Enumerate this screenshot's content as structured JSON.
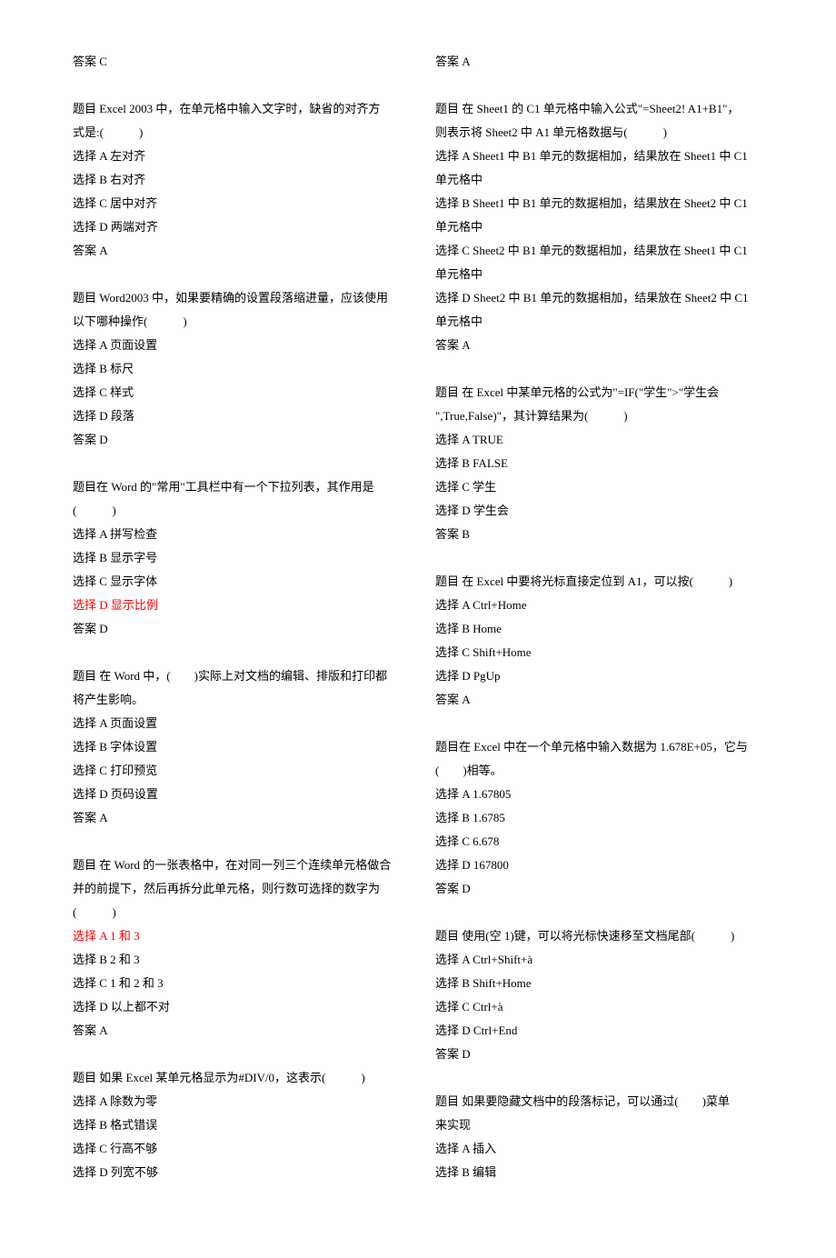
{
  "left": {
    "ans0": "答案 C",
    "q1": {
      "stem1": "题目 Excel 2003 中，在单元格中输入文字时，缺省的对齐方",
      "stem2": "式是:(　　　)",
      "a": "选择 A 左对齐",
      "b": "选择 B 右对齐",
      "c": "选择 C 居中对齐",
      "d": "选择 D 两端对齐",
      "ans": "答案 A"
    },
    "q2": {
      "stem1": "题目 Word2003 中，如果要精确的设置段落缩进量，应该使用",
      "stem2": "以下哪种操作(　　　)",
      "a": "选择 A 页面设置",
      "b": "选择 B 标尺",
      "c": "选择 C 样式",
      "d": "选择 D 段落",
      "ans": "答案 D"
    },
    "q3": {
      "stem1": "题目在 Word 的\"常用\"工具栏中有一个下拉列表，其作用是",
      "stem2": "(　　　)",
      "a": "选择 A 拼写检查",
      "b": "选择 B 显示字号",
      "c": "选择 C 显示字体",
      "d": "选择 D 显示比例",
      "ans": "答案 D"
    },
    "q4": {
      "stem1": "题目 在 Word 中，(　　)实际上对文档的编辑、排版和打印都",
      "stem2": "将产生影响。",
      "a": "选择 A 页面设置",
      "b": "选择 B 字体设置",
      "c": "选择 C 打印预览",
      "d": "选择 D 页码设置",
      "ans": "答案 A"
    },
    "q5": {
      "stem1": "题目 在 Word 的一张表格中，在对同一列三个连续单元格做合",
      "stem2": "并的前提下，然后再拆分此单元格，则行数可选择的数字为",
      "stem3": "(　　　)",
      "a": "选择 A 1 和 3",
      "b": "选择 B 2 和 3",
      "c": "选择 C 1 和 2 和 3",
      "d": "选择 D 以上都不对",
      "ans": "答案 A"
    },
    "q6": {
      "stem1": "题目 如果 Excel 某单元格显示为#DIV/0，这表示(　　　)",
      "a": "选择 A 除数为零",
      "b": "选择 B 格式错误",
      "c": "选择 C 行高不够",
      "d": "选择 D 列宽不够"
    }
  },
  "right": {
    "ans0": "答案 A",
    "q1": {
      "stem1": "题目 在 Sheet1 的 C1 单元格中输入公式\"=Sheet2! A1+B1\"，",
      "stem2": "则表示将 Sheet2 中 A1 单元格数据与(　　　)",
      "a1": "选择 A Sheet1 中 B1 单元的数据相加，结果放在 Sheet1 中 C1",
      "a2": "单元格中",
      "b1": "选择 B Sheet1 中 B1 单元的数据相加，结果放在 Sheet2 中 C1",
      "b2": "单元格中",
      "c1": "选择 C Sheet2 中 B1 单元的数据相加，结果放在 Sheet1 中 C1",
      "c2": "单元格中",
      "d1": "选择 D Sheet2 中 B1 单元的数据相加，结果放在 Sheet2 中 C1",
      "d2": "单元格中",
      "ans": "答案 A"
    },
    "q2": {
      "stem1": "题目 在 Excel 中某单元格的公式为\"=IF(\"学生\">\"学生会",
      "stem2": "\",True,False)\"，其计算结果为(　　　)",
      "a": "选择 A TRUE",
      "b": "选择 B FALSE",
      "c": "选择 C 学生",
      "d": "选择 D 学生会",
      "ans": "答案 B"
    },
    "q3": {
      "stem1": "题目 在 Excel 中要将光标直接定位到 A1，可以按(　　　)",
      "a": "选择 A Ctrl+Home",
      "b": "选择 B Home",
      "c": "选择 C Shift+Home",
      "d": "选择 D PgUp",
      "ans": "答案 A"
    },
    "q4": {
      "stem1": "题目在 Excel 中在一个单元格中输入数据为 1.678E+05，它与",
      "stem2": "(　　)相等。",
      "a": "选择 A 1.67805",
      "b": "选择 B 1.6785",
      "c": "选择 C 6.678",
      "d": "选择 D 167800",
      "ans": "答案 D"
    },
    "q5": {
      "stem1": "题目 使用(空 1)键，可以将光标快速移至文档尾部(　　　)",
      "a": "选择 A Ctrl+Shift+à",
      "b": "选择 B Shift+Home",
      "c": "选择 C Ctrl+à",
      "d": "选择 D Ctrl+End",
      "ans": "答案 D"
    },
    "q6": {
      "stem1": "题目 如果要隐藏文档中的段落标记，可以通过(　　)菜单",
      "stem2": "来实现",
      "a": "选择 A 插入",
      "b": "选择 B 编辑"
    }
  }
}
